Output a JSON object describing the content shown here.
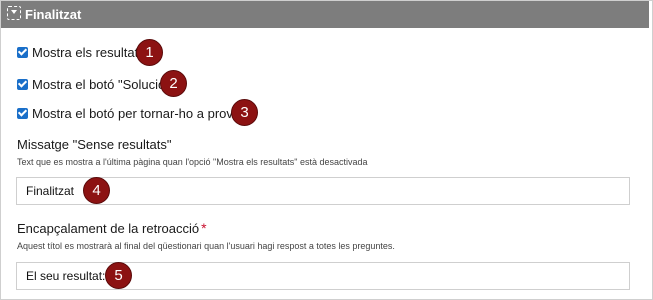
{
  "panel": {
    "title": "Finalitzat",
    "icon": "collapse-icon"
  },
  "options": [
    {
      "label": "Mostra els resultats",
      "checked": true,
      "badge": "1"
    },
    {
      "label": "Mostra el botó \"Solució\"",
      "checked": true,
      "badge": "2"
    },
    {
      "label": "Mostra el botó per tornar-ho a provar",
      "checked": true,
      "badge": "3"
    }
  ],
  "no_results": {
    "label": "Missatge \"Sense resultats\"",
    "help": "Text que es mostra a l'última pàgina quan l'opció \"Mostra els resultats\" està desactivada",
    "value": "Finalitzat",
    "badge": "4"
  },
  "feedback_heading": {
    "label": "Encapçalament de la retroacció",
    "required_mark": "*",
    "help": "Aquest títol es mostrarà al final del qüestionari quan l'usuari hagi respost a totes les preguntes.",
    "value": "El seu resultat:",
    "badge": "5"
  },
  "colors": {
    "header_bg": "#7d7d7d",
    "checkbox": "#1a6fc9",
    "badge_bg": "#8c1212",
    "required": "#c8102e"
  }
}
